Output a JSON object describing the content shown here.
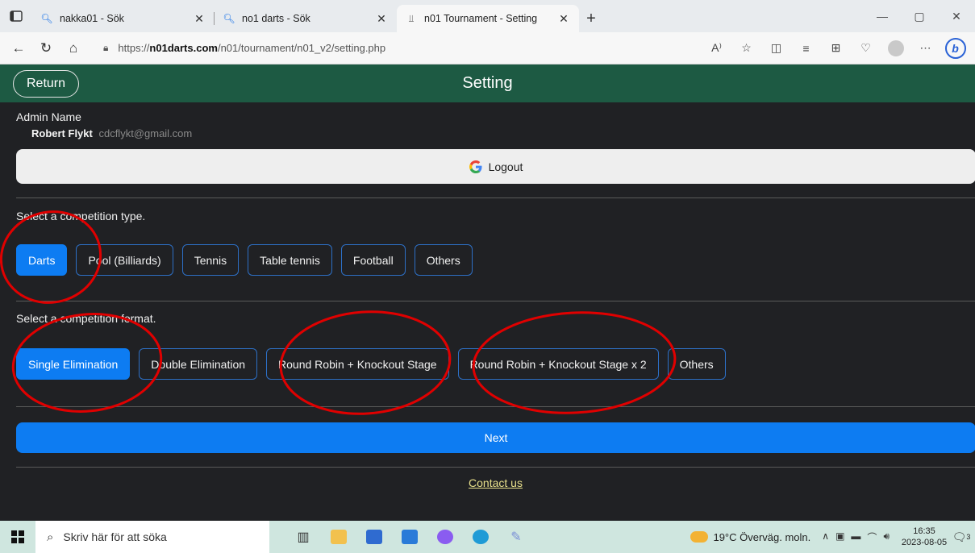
{
  "browser": {
    "tabs": [
      {
        "title": "nakka01 - Sök",
        "icon": "search-icon"
      },
      {
        "title": "no1 darts - Sök",
        "icon": "search-icon"
      },
      {
        "title": "n01 Tournament - Setting",
        "icon": "bracket-icon"
      }
    ],
    "url_prefix": "https://",
    "url_host": "n01darts.com",
    "url_path": "/n01/tournament/n01_v2/setting.php"
  },
  "header": {
    "return_label": "Return",
    "title": "Setting",
    "color": "#1d5a43"
  },
  "admin": {
    "label": "Admin Name",
    "name": "Robert Flykt",
    "email": "cdcflykt@gmail.com",
    "logout_label": "Logout"
  },
  "competition_type": {
    "prompt": "Select a competition type.",
    "options": [
      "Darts",
      "Pool (Billiards)",
      "Tennis",
      "Table tennis",
      "Football",
      "Others"
    ],
    "selected": "Darts"
  },
  "competition_format": {
    "prompt": "Select a competition format.",
    "options": [
      "Single Elimination",
      "Double Elimination",
      "Round Robin + Knockout Stage",
      "Round Robin + Knockout Stage x 2",
      "Others"
    ],
    "selected": "Single Elimination"
  },
  "next_label": "Next",
  "contact_label": "Contact us",
  "accent_color": "#0d7cf2",
  "annotation_color": "#e00000",
  "taskbar": {
    "search_placeholder": "Skriv här för att söka",
    "weather": "19°C Överväg. moln.",
    "time": "16:35",
    "date": "2023-08-05",
    "notification_count": "3"
  }
}
